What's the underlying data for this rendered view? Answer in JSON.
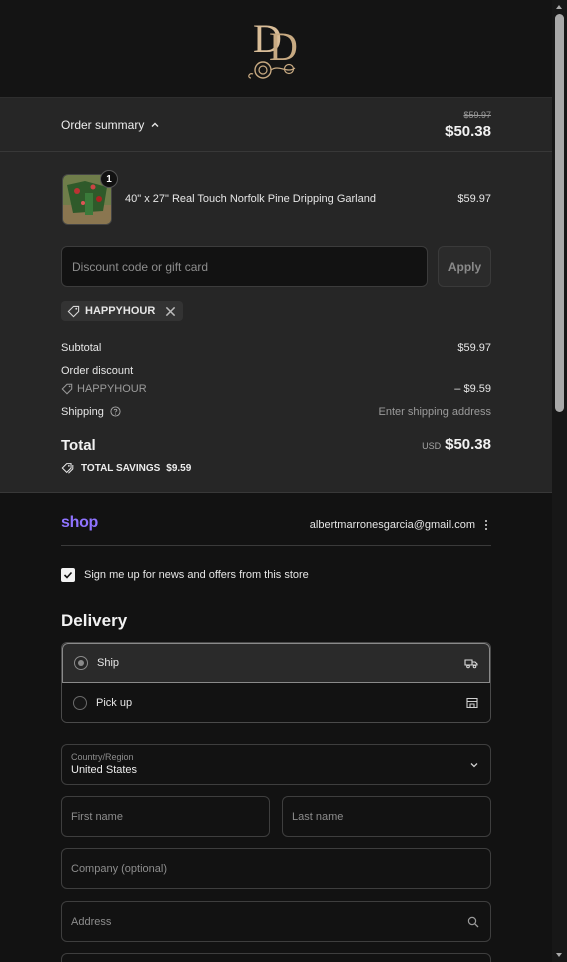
{
  "header": {
    "logo_monogram": "DD"
  },
  "summary_bar": {
    "toggle_label": "Order summary",
    "original_total": "$59.97",
    "total": "$50.38"
  },
  "cart": {
    "items": [
      {
        "name": "40\" x 27\" Real Touch Norfolk Pine Dripping Garland",
        "price": "$59.97",
        "quantity": "1"
      }
    ]
  },
  "discount": {
    "placeholder": "Discount code or gift card",
    "apply_label": "Apply",
    "applied_code": "HAPPYHOUR"
  },
  "totals": {
    "subtotal_label": "Subtotal",
    "subtotal_value": "$59.97",
    "order_discount_label": "Order discount",
    "discount_code": "HAPPYHOUR",
    "discount_value": "– $9.59",
    "shipping_label": "Shipping",
    "shipping_value": "Enter shipping address",
    "total_label": "Total",
    "currency": "USD",
    "total_value": "$50.38",
    "savings_label": "TOTAL SAVINGS",
    "savings_value": "$9.59"
  },
  "shop": {
    "logo": "shop",
    "email": "albertmarronesgarcia@gmail.com"
  },
  "newsletter": {
    "label": "Sign me up for news and offers from this store",
    "checked": true
  },
  "delivery": {
    "title": "Delivery",
    "options": [
      {
        "label": "Ship",
        "selected": true,
        "icon": "truck-icon"
      },
      {
        "label": "Pick up",
        "selected": false,
        "icon": "store-icon"
      }
    ]
  },
  "form": {
    "country_label": "Country/Region",
    "country_value": "United States",
    "first_name_placeholder": "First name",
    "last_name_placeholder": "Last name",
    "company_placeholder": "Company (optional)",
    "address_placeholder": "Address"
  },
  "colors": {
    "background": "#121212",
    "summary_background": "#262626",
    "shop_brand": "#8f73ff"
  }
}
